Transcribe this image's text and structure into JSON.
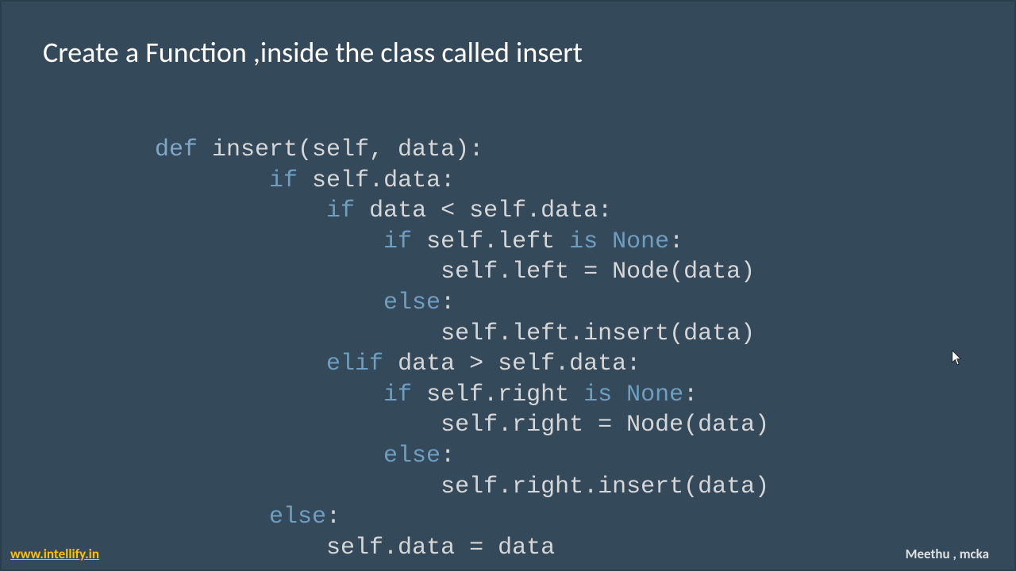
{
  "title": "Create a Function ,inside the class called insert",
  "footer": {
    "link": "www.intellify.in",
    "author": "Meethu , mcka"
  },
  "code": {
    "kw": {
      "def": "def",
      "if": "if",
      "elif": "elif",
      "else": "else",
      "is": "is",
      "none": "None"
    },
    "tokens": {
      "sig_open": " insert(self, data):",
      "l2": " self.data:",
      "l3": " data < self.data:",
      "l4a": " self.left ",
      "l4b": ":",
      "l5": "self.left = Node(data)",
      "l6": ":",
      "l7": "self.left.insert(data)",
      "l8": " data > self.data:",
      "l9a": " self.right ",
      "l9b": ":",
      "l10": "self.right = Node(data)",
      "l11": ":",
      "l12": "self.right.insert(data)",
      "l13": ":",
      "l14": "self.data = data"
    },
    "indent": {
      "i0": "",
      "i1": "        ",
      "i2": "            ",
      "i3": "                ",
      "i4": "                    "
    }
  }
}
